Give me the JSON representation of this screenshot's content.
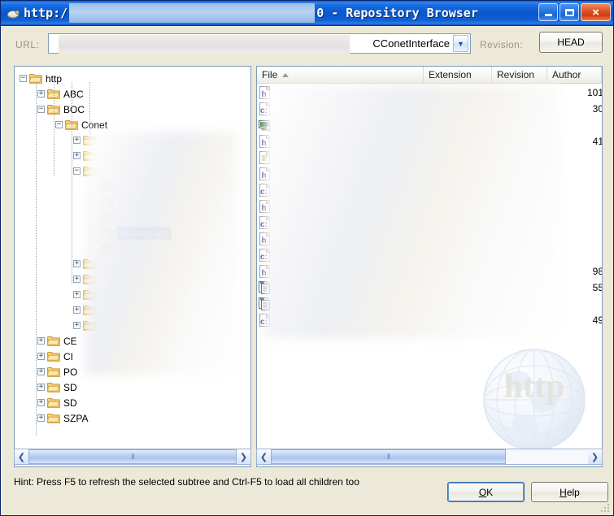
{
  "window": {
    "title_prefix": "http:/",
    "title_suffix": "0 - Repository Browser",
    "icon": "tortoise-svn-icon",
    "minimize_label": "",
    "maximize_label": "",
    "close_label": "×"
  },
  "toolbar": {
    "url_label": "URL:",
    "url_value": "CConetInterface",
    "url_prefix_visible": "h",
    "dropdown_icon": "chevron-down-icon",
    "revision_label": "Revision:",
    "revision_button": "HEAD"
  },
  "tree": {
    "nodes": [
      {
        "label": "http",
        "depth": 0,
        "state": "expanded",
        "selected": false
      },
      {
        "label": "ABC",
        "depth": 1,
        "state": "collapsed",
        "selected": false
      },
      {
        "label": "BOC",
        "depth": 1,
        "state": "expanded",
        "selected": false
      },
      {
        "label": "Conet",
        "depth": 2,
        "state": "expanded",
        "selected": false
      },
      {
        "label": "",
        "depth": 3,
        "state": "collapsed",
        "selected": false
      },
      {
        "label": "",
        "depth": 3,
        "state": "collapsed",
        "selected": false
      },
      {
        "label": "",
        "depth": 3,
        "state": "expanded",
        "selected": false
      },
      {
        "label": "",
        "depth": 4,
        "state": "leaf",
        "selected": false
      },
      {
        "label": "",
        "depth": 4,
        "state": "leaf",
        "selected": false
      },
      {
        "label": "",
        "depth": 4,
        "state": "leaf",
        "selected": false
      },
      {
        "label": "netInterface",
        "depth": 4,
        "state": "leaf",
        "selected": true
      },
      {
        "label": "",
        "depth": 4,
        "state": "leaf",
        "selected": false
      },
      {
        "label": "",
        "depth": 3,
        "state": "collapsed",
        "selected": false
      },
      {
        "label": "",
        "depth": 3,
        "state": "collapsed",
        "selected": false
      },
      {
        "label": "",
        "depth": 3,
        "state": "collapsed",
        "selected": false
      },
      {
        "label": "",
        "depth": 3,
        "state": "collapsed",
        "selected": false
      },
      {
        "label": "",
        "depth": 3,
        "state": "collapsed",
        "selected": false
      },
      {
        "label": "CE",
        "depth": 1,
        "state": "collapsed",
        "selected": false
      },
      {
        "label": "CI",
        "depth": 1,
        "state": "collapsed",
        "selected": false
      },
      {
        "label": "PO",
        "depth": 1,
        "state": "collapsed",
        "selected": false
      },
      {
        "label": "SD",
        "depth": 1,
        "state": "collapsed",
        "selected": false
      },
      {
        "label": "SD",
        "depth": 1,
        "state": "collapsed",
        "selected": false
      },
      {
        "label": "SZPA",
        "depth": 1,
        "state": "collapsed",
        "selected": false
      }
    ]
  },
  "filelist": {
    "columns": [
      {
        "label": "File",
        "sorted": "asc"
      },
      {
        "label": "Extension",
        "sorted": ""
      },
      {
        "label": "Revision",
        "sorted": ""
      },
      {
        "label": "Author",
        "sorted": ""
      }
    ],
    "rows": [
      {
        "icon": "cpp-file-icon",
        "name": "",
        "extension": "",
        "revision": "49",
        "author": ""
      },
      {
        "icon": "copy-pages-icon",
        "name": "",
        "extension": "",
        "revision": "",
        "author": ""
      },
      {
        "icon": "copy-pages-icon",
        "name": "",
        "extension": "",
        "revision": "55",
        "author": ""
      },
      {
        "icon": "header-file-icon",
        "name": "",
        "extension": "",
        "revision": "98",
        "author": ""
      },
      {
        "icon": "cpp-file-icon",
        "name": "",
        "extension": "",
        "revision": "",
        "author": ""
      },
      {
        "icon": "header-file-icon",
        "name": "",
        "extension": "",
        "revision": "",
        "author": ""
      },
      {
        "icon": "cpp-file-icon",
        "name": "",
        "extension": "",
        "revision": "",
        "author": ""
      },
      {
        "icon": "header-file-icon",
        "name": "",
        "extension": "",
        "revision": "",
        "author": ""
      },
      {
        "icon": "cpp-file-icon",
        "name": "",
        "extension": "",
        "revision": "",
        "author": ""
      },
      {
        "icon": "header-file-icon",
        "name": "",
        "extension": "",
        "revision": "",
        "author": ""
      },
      {
        "icon": "text-file-icon",
        "name": "",
        "extension": "",
        "revision": "",
        "author": ""
      },
      {
        "icon": "header-file-icon",
        "name": "",
        "extension": "",
        "revision": "41",
        "author": ""
      },
      {
        "icon": "application-icon",
        "name": "",
        "extension": "",
        "revision": "",
        "author": ""
      },
      {
        "icon": "cpp-file-icon",
        "name": "",
        "extension": "",
        "revision": "30",
        "author": ""
      },
      {
        "icon": "header-file-icon",
        "name": "",
        "extension": "",
        "revision": "101",
        "author": ""
      }
    ]
  },
  "scrollbars": {
    "left_arrow_icon": "❮",
    "right_arrow_icon": "❯",
    "grip_glyph": "‖"
  },
  "watermark": {
    "text": "http"
  },
  "footer": {
    "hint": "Hint: Press F5 to refresh the selected subtree and Ctrl-F5 to load all children too",
    "ok_label": "OK",
    "ok_accel": "O",
    "help_label": "Help",
    "help_accel": "H"
  },
  "colors": {
    "title_blue": "#0A5FD4",
    "dialog_bg": "#ECE9D8",
    "selection_blue": "#2A5FC9",
    "folder_yellow": "#F6D27E",
    "close_red": "#E35B29"
  }
}
